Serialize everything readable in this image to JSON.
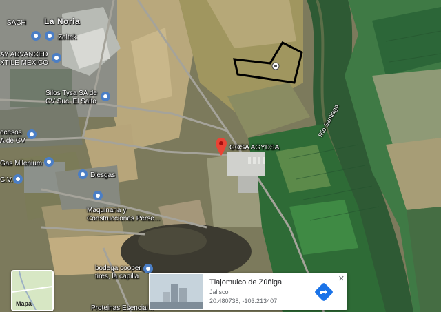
{
  "map": {
    "labels": {
      "la_noria": "La Noria",
      "sach": "SACH",
      "zoltek": "Zoltek",
      "advanced": "AY ADVANCED",
      "xtile": "XTILE MEXICO",
      "silos1": "Silos Tysa SA de",
      "silos2": "CV Suc. El Salto",
      "procesos": "ocesos",
      "de_cv": "A de CV",
      "gas": "Gas Milenium",
      "cv": "C.V.",
      "diesgas": "Diesgas",
      "maq1": "Maquinaria y",
      "maq2": "Construcciones Perse...",
      "gosa": "GOSA AGYDSA",
      "rio": "Río Santiago",
      "bodega1": "bodega cooper",
      "bodega2": "tires, la capilla",
      "proteinas": "Proteinas Esencial..."
    },
    "colors": {
      "pin": "#ea4335",
      "place_pin": "#4b7ec5",
      "field_dark": "#24532e",
      "field_light": "#c8b889",
      "road": "#a5a39a",
      "parcel_outline": "#000000"
    }
  },
  "layer_button": {
    "label": "Mapa"
  },
  "info_card": {
    "title": "Tlajomulco de Zúñiga",
    "region": "Jalisco",
    "coordinates": "20.480738, -103.213407",
    "close_icon": "close-icon",
    "directions_icon": "directions-icon",
    "accent": "#1a73e8"
  }
}
